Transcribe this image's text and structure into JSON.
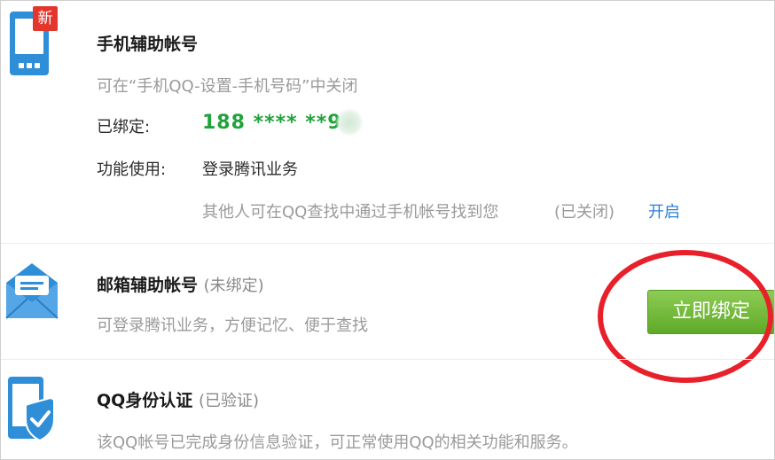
{
  "phone_section": {
    "badge": "新",
    "title": "手机辅助帐号",
    "description": "可在“手机QQ-设置-手机号码”中关闭",
    "bound_label": "已绑定:",
    "bound_value": "188 **** **9",
    "function_label": "功能使用:",
    "function_value": "登录腾讯业务",
    "search_note": "其他人可在QQ查找中通过手机帐号找到您",
    "search_status": "(已关闭)",
    "enable_link": "开启"
  },
  "email_section": {
    "title": "邮箱辅助帐号",
    "status": "(未绑定)",
    "description": "可登录腾讯业务，方便记忆、便于查找",
    "bind_button": "立即绑定"
  },
  "identity_section": {
    "title": "QQ身份认证",
    "status": "(已验证)",
    "description": "该QQ帐号已完成身份信息验证，可正常使用QQ的相关功能和服务。"
  },
  "colors": {
    "accent_green": "#20a33a",
    "button_green": "#6db534",
    "link_blue": "#2b7fd6",
    "icon_blue": "#2f8ed8",
    "badge_red": "#e3372d",
    "annotation_red": "#e8202a"
  },
  "icons": {
    "phone": "phone-icon",
    "email": "mail-icon",
    "identity": "shield-check-icon"
  }
}
